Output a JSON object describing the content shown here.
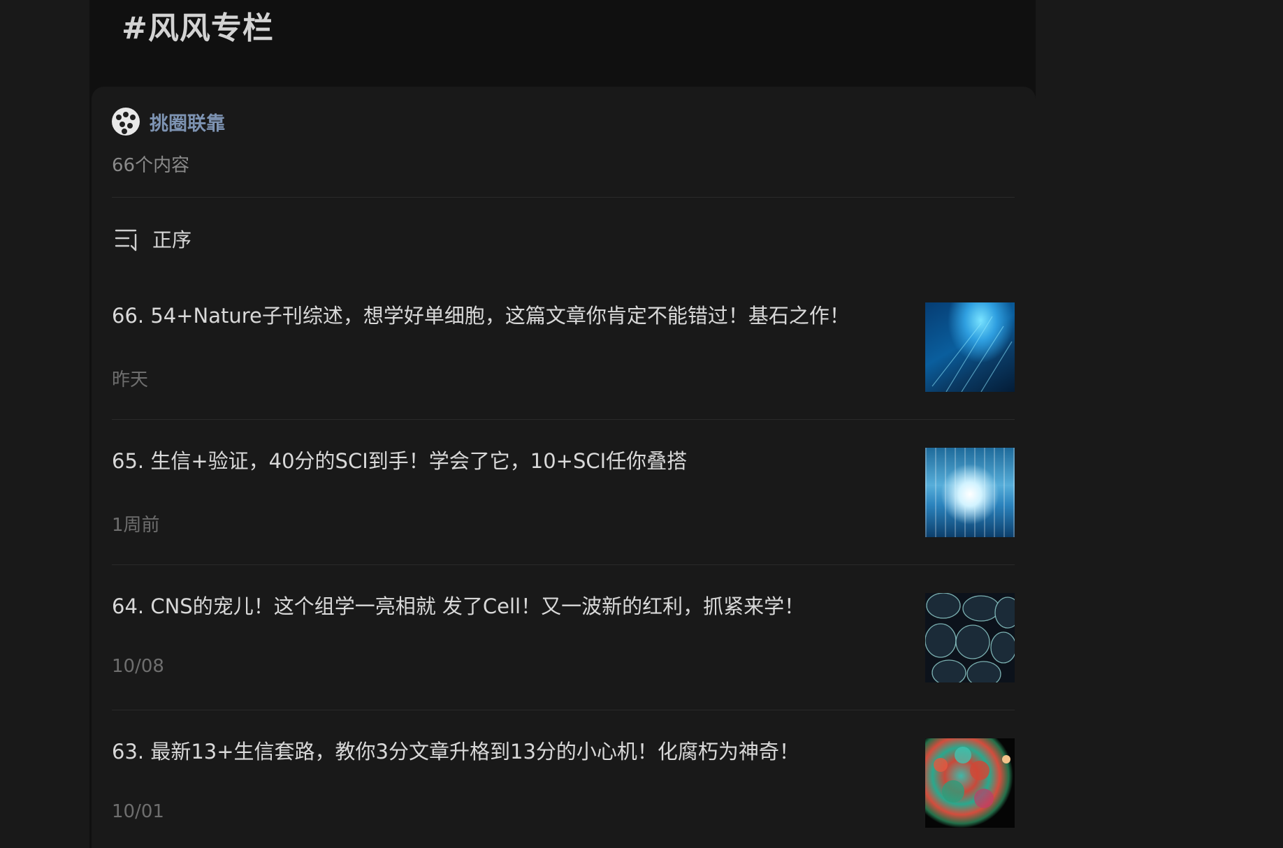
{
  "page": {
    "topic_title": "#风风专栏"
  },
  "author": {
    "name": "挑圈联靠",
    "content_count": "66个内容"
  },
  "sort": {
    "icon": "sort-ascending-icon",
    "label": "正序"
  },
  "articles": [
    {
      "title": "66. 54+Nature子刊综述，想学好单细胞，这篇文章你肯定不能错过！基石之作！",
      "date": "昨天"
    },
    {
      "title": "65. 生信+验证，40分的SCI到手！学会了它，10+SCI任你叠搭",
      "date": "1周前"
    },
    {
      "title": "64. CNS的宠儿！这个组学一亮相就 发了Cell！又一波新的红利，抓紧来学！",
      "date": "10/08"
    },
    {
      "title": "63. 最新13+生信套路，教你3分文章升格到13分的小心机！化腐朽为神奇！",
      "date": "10/01"
    }
  ],
  "colors": {
    "page_background": "#191919",
    "header_background": "#101010",
    "card_background": "#191919",
    "author_name": "#7d93b2",
    "secondary_text": "#6e6e6e"
  }
}
